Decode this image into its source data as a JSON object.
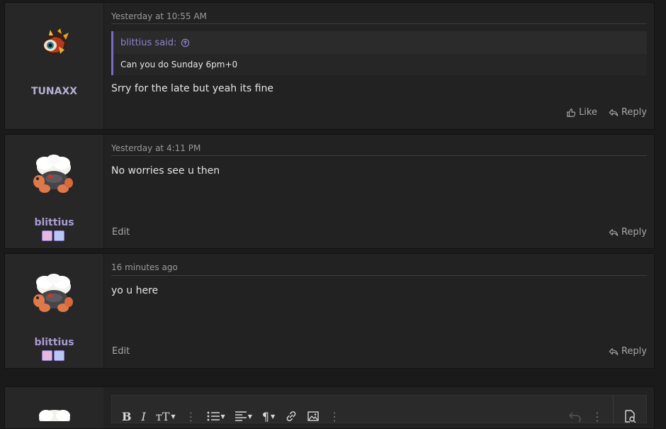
{
  "posts": [
    {
      "username": "TUNAXX",
      "timestamp": "Yesterday at 10:55 AM",
      "quote": {
        "author_label": "blittius said:",
        "text": "Can you do Sunday 6pm+0"
      },
      "message": "Srry for the late but yeah its fine",
      "actions": [
        "Like",
        "Reply"
      ]
    },
    {
      "username": "blittius",
      "timestamp": "Yesterday at 4:11 PM",
      "message": "No worries see u then",
      "edit_label": "Edit",
      "actions": [
        "Reply"
      ]
    },
    {
      "username": "blittius",
      "timestamp": "16 minutes ago",
      "message": "yo u here",
      "edit_label": "Edit",
      "actions": [
        "Reply"
      ]
    }
  ],
  "editor": {
    "toolbar": [
      "bold-icon",
      "italic-icon",
      "text-size-icon",
      "more-icon",
      "list-icon",
      "align-icon",
      "paragraph-icon",
      "link-icon",
      "image-icon",
      "more-icon",
      "undo-icon",
      "more-icon",
      "preview-icon"
    ]
  },
  "colors": {
    "background": "#1a1a1a",
    "post_bg": "#222222",
    "username": "#a99cd3",
    "quote_accent": "#7c6bc4",
    "text": "#e4e4e4",
    "muted": "#9a9a9a"
  }
}
